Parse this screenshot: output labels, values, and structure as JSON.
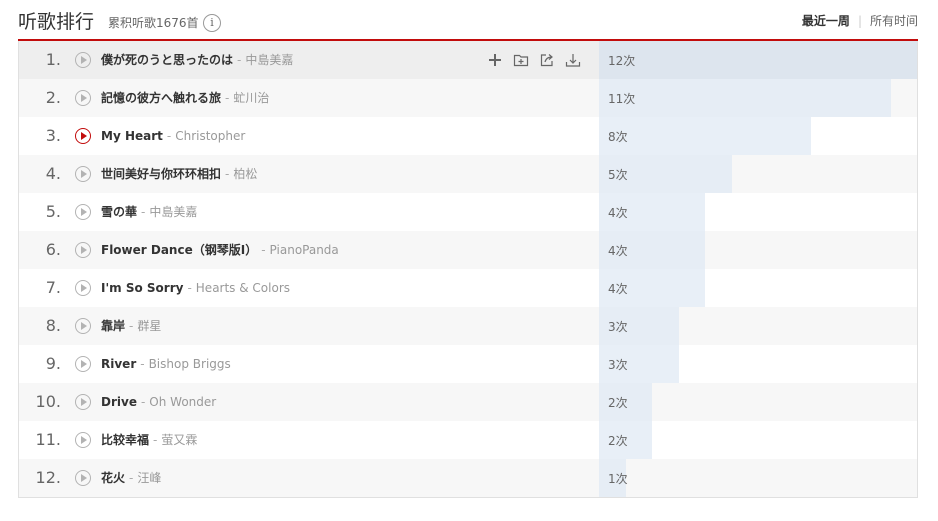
{
  "header": {
    "title": "听歌排行",
    "subtitle": "累积听歌1676首",
    "info_icon": "i",
    "period_week": "最近一周",
    "period_separator": "|",
    "period_all": "所有时间"
  },
  "colors": {
    "accent": "#c20c0c",
    "count_bar": "#e8eff7"
  },
  "ops_icons": [
    "add-icon",
    "add-to-playlist-icon",
    "share-icon",
    "download-icon"
  ],
  "rows": [
    {
      "rank": "1.",
      "song": "僕が死のうと思ったのは",
      "artist": "中島美嘉",
      "count": "12次",
      "plays": 12
    },
    {
      "rank": "2.",
      "song": "記憶の彼方へ触れる旅",
      "artist": "虻川治",
      "count": "11次",
      "plays": 11
    },
    {
      "rank": "3.",
      "song": "My Heart",
      "artist": "Christopher",
      "count": "8次",
      "plays": 8
    },
    {
      "rank": "4.",
      "song": "世间美好与你环环相扣",
      "artist": "柏松",
      "count": "5次",
      "plays": 5
    },
    {
      "rank": "5.",
      "song": "雪の華",
      "artist": "中島美嘉",
      "count": "4次",
      "plays": 4
    },
    {
      "rank": "6.",
      "song": "Flower Dance（钢琴版I）",
      "artist": "PianoPanda",
      "count": "4次",
      "plays": 4
    },
    {
      "rank": "7.",
      "song": "I'm So Sorry",
      "artist": "Hearts & Colors",
      "count": "4次",
      "plays": 4
    },
    {
      "rank": "8.",
      "song": "靠岸",
      "artist": "群星",
      "count": "3次",
      "plays": 3
    },
    {
      "rank": "9.",
      "song": "River",
      "artist": "Bishop Briggs",
      "count": "3次",
      "plays": 3
    },
    {
      "rank": "10.",
      "song": "Drive",
      "artist": "Oh Wonder",
      "count": "2次",
      "plays": 2
    },
    {
      "rank": "11.",
      "song": "比较幸福",
      "artist": "萤又霖",
      "count": "2次",
      "plays": 2
    },
    {
      "rank": "12.",
      "song": "花火",
      "artist": "汪峰",
      "count": "1次",
      "plays": 1
    }
  ]
}
